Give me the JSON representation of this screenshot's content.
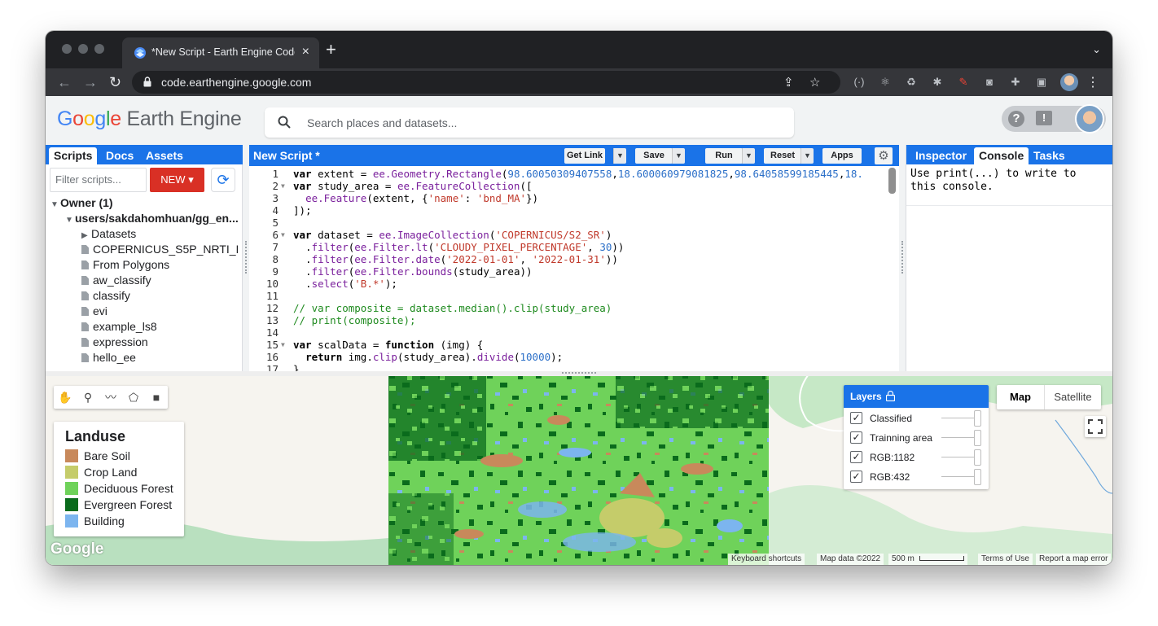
{
  "browser": {
    "tab_title": "*New Script - Earth Engine Code Editor",
    "url": "code.earthengine.google.com"
  },
  "header": {
    "logo_google": "Google",
    "logo_rest": "Earth Engine",
    "search_placeholder": "Search places and datasets..."
  },
  "left_panel": {
    "tabs": [
      "Scripts",
      "Docs",
      "Assets"
    ],
    "filter_placeholder": "Filter scripts...",
    "new_button": "NEW",
    "tree": [
      {
        "label": "Owner (1)",
        "kind": "group"
      },
      {
        "label": "users/sakdahomhuan/gg_en...",
        "kind": "repo"
      },
      {
        "label": "Datasets",
        "kind": "folder"
      },
      {
        "label": "COPERNICUS_S5P_NRTI_L...",
        "kind": "file"
      },
      {
        "label": "From Polygons",
        "kind": "file"
      },
      {
        "label": "aw_classify",
        "kind": "file"
      },
      {
        "label": "classify",
        "kind": "file"
      },
      {
        "label": "evi",
        "kind": "file"
      },
      {
        "label": "example_ls8",
        "kind": "file"
      },
      {
        "label": "expression",
        "kind": "file"
      },
      {
        "label": "hello_ee",
        "kind": "file"
      }
    ]
  },
  "editor": {
    "title": "New Script *",
    "buttons": {
      "get_link": "Get Link",
      "save": "Save",
      "run": "Run",
      "reset": "Reset",
      "apps": "Apps"
    },
    "line_numbers": [
      "1",
      "2",
      "3",
      "4",
      "5",
      "6",
      "7",
      "8",
      "9",
      "10",
      "11",
      "12",
      "13",
      "14",
      "15",
      "16",
      "17"
    ]
  },
  "right_panel": {
    "tabs": [
      "Inspector",
      "Console",
      "Tasks"
    ],
    "console_message": "Use print(...) to write to this console."
  },
  "map": {
    "draw_tools": [
      "hand-icon",
      "marker-icon",
      "line-icon",
      "polygon-icon",
      "rectangle-icon"
    ],
    "legend": {
      "title": "Landuse",
      "items": [
        {
          "label": "Bare Soil",
          "color": "#c8895b"
        },
        {
          "label": "Crop Land",
          "color": "#c5cc6a"
        },
        {
          "label": "Deciduous Forest",
          "color": "#6fd25a"
        },
        {
          "label": "Evergreen Forest",
          "color": "#0a6b1c"
        },
        {
          "label": "Building",
          "color": "#7cb5ef"
        }
      ]
    },
    "layers": {
      "title": "Layers",
      "items": [
        {
          "label": "Classified",
          "checked": true
        },
        {
          "label": "Trainning area",
          "checked": true
        },
        {
          "label": "RGB:1182",
          "checked": true
        },
        {
          "label": "RGB:432",
          "checked": true
        }
      ]
    },
    "map_type": {
      "map": "Map",
      "satellite": "Satellite"
    },
    "google_logo": "Google",
    "attribution": {
      "keyboard": "Keyboard shortcuts",
      "data": "Map data ©2022",
      "scale": "500 m",
      "terms": "Terms of Use",
      "report": "Report a map error"
    }
  },
  "colors": {
    "accent": "#1a73e8",
    "new_button": "#d93025"
  }
}
